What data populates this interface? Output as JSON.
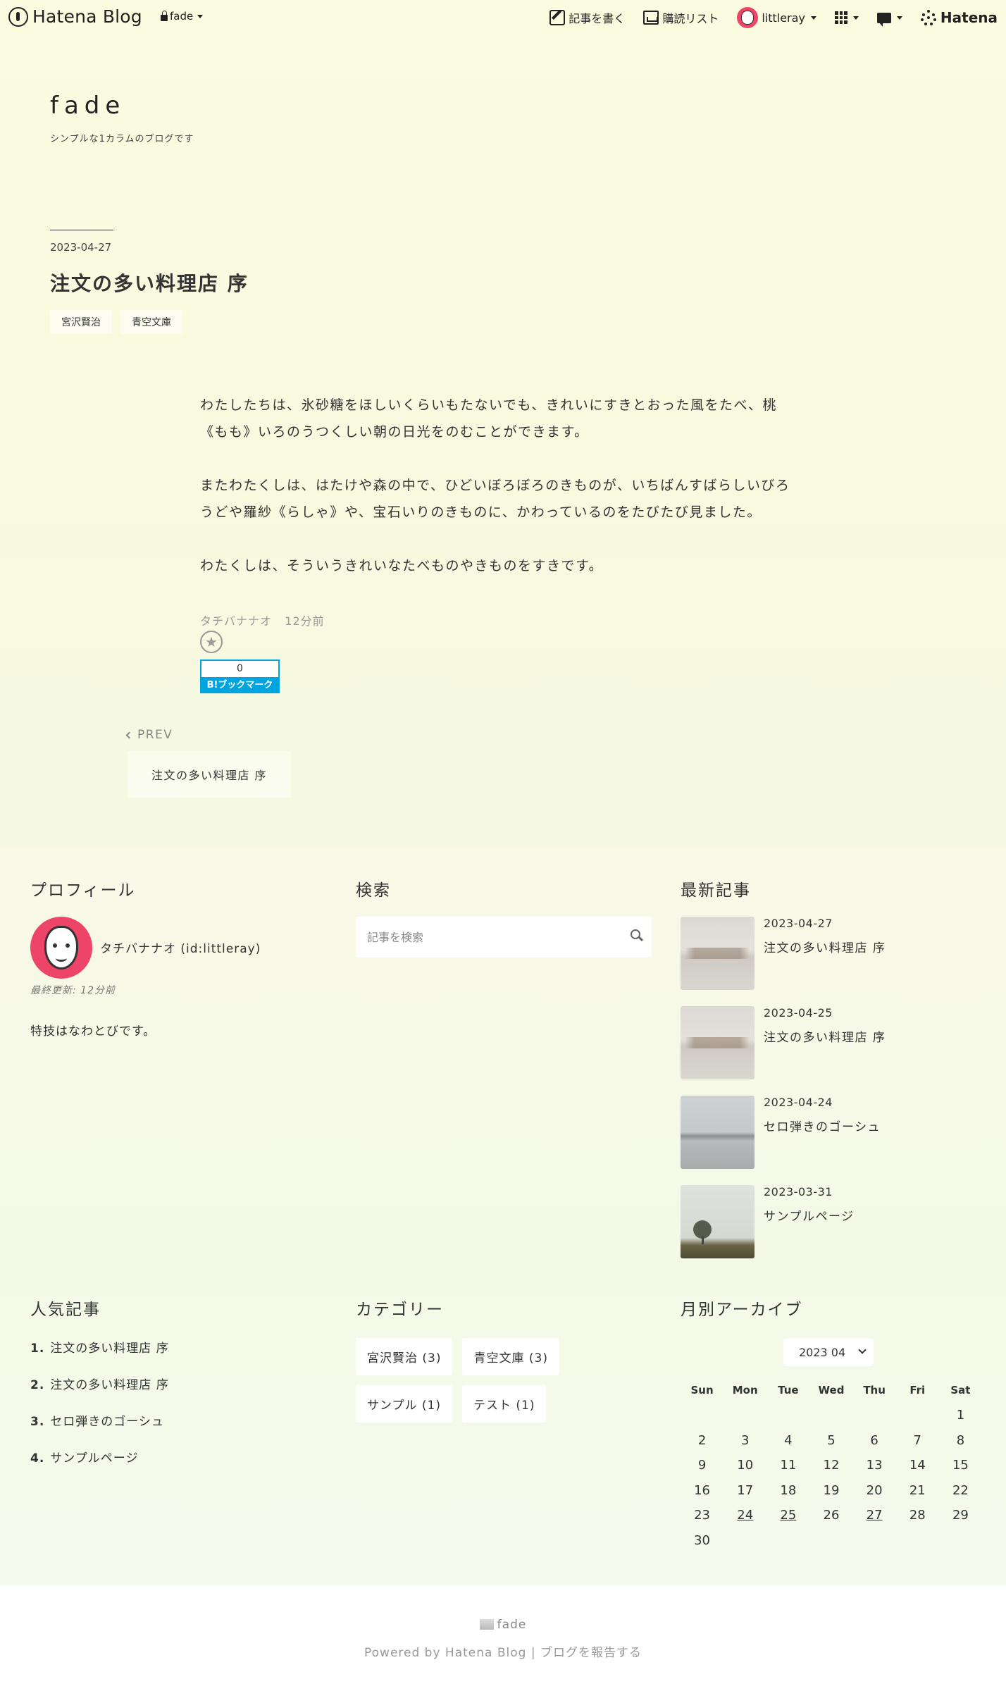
{
  "topbar": {
    "logo_text": "Hatena Blog",
    "blog_select": "fade",
    "write_label": "記事を書く",
    "reading_list_label": "購読リスト",
    "user_label": "littleray",
    "brand_label": "Hatena"
  },
  "header": {
    "title": "fade",
    "description": "シンプルな1カラムのブログです"
  },
  "entry": {
    "date": "2023-04-27",
    "title": "注文の多い料理店 序",
    "tags": [
      "宮沢賢治",
      "青空文庫"
    ],
    "paragraphs": [
      "わたしたちは、氷砂糖をほしいくらいもたないでも、きれいにすきとおった風をたべ、桃《もも》いろのうつくしい朝の日光をのむことができます。",
      "またわたくしは、はたけや森の中で、ひどいぼろぼろのきものが、いちばんすばらしいびろうどや羅紗《らしゃ》や、宝石いりのきものに、かわっているのをたびたび見ました。",
      "わたくしは、そういうきれいなたべものやきものをすきです。"
    ],
    "author": "タチバナナオ",
    "time_ago": "12分前",
    "bookmark_count": "0",
    "bookmark_label": "B!ブックマーク"
  },
  "pager": {
    "label": "PREV",
    "link_title": "注文の多い料理店 序"
  },
  "profile": {
    "heading": "プロフィール",
    "name": "タチバナナオ (id:littleray)",
    "updated": "最終更新: 12分前",
    "description": "特技はなわとびです。"
  },
  "search": {
    "heading": "検索",
    "placeholder": "記事を検索"
  },
  "recent": {
    "heading": "最新記事",
    "items": [
      {
        "date": "2023-04-27",
        "title": "注文の多い料理店 序"
      },
      {
        "date": "2023-04-25",
        "title": "注文の多い料理店 序"
      },
      {
        "date": "2023-04-24",
        "title": "セロ弾きのゴーシュ"
      },
      {
        "date": "2023-03-31",
        "title": "サンプルページ"
      }
    ]
  },
  "popular": {
    "heading": "人気記事",
    "items": [
      {
        "num": "1.",
        "title": "注文の多い料理店 序"
      },
      {
        "num": "2.",
        "title": "注文の多い料理店 序"
      },
      {
        "num": "3.",
        "title": "セロ弾きのゴーシュ"
      },
      {
        "num": "4.",
        "title": "サンプルページ"
      }
    ]
  },
  "categories": {
    "heading": "カテゴリー",
    "items": [
      "宮沢賢治 (3)",
      "青空文庫 (3)",
      "サンプル (1)",
      "テスト (1)"
    ]
  },
  "archive": {
    "heading": "月別アーカイブ",
    "selected": "2023 04",
    "weekdays": [
      "Sun",
      "Mon",
      "Tue",
      "Wed",
      "Thu",
      "Fri",
      "Sat"
    ],
    "weeks": [
      [
        "",
        "",
        "",
        "",
        "",
        "",
        "1"
      ],
      [
        "2",
        "3",
        "4",
        "5",
        "6",
        "7",
        "8"
      ],
      [
        "9",
        "10",
        "11",
        "12",
        "13",
        "14",
        "15"
      ],
      [
        "16",
        "17",
        "18",
        "19",
        "20",
        "21",
        "22"
      ],
      [
        "23",
        "24",
        "25",
        "26",
        "27",
        "28",
        "29"
      ],
      [
        "30",
        "",
        "",
        "",
        "",
        "",
        ""
      ]
    ],
    "linked_days": [
      "24",
      "25",
      "27"
    ]
  },
  "footer": {
    "blog_name": "fade",
    "powered": "Powered by Hatena Blog",
    "separator": "|",
    "report": "ブログを報告する"
  },
  "colors": {
    "accent_bookmark": "#00a4de",
    "avatar_pink": "#ee4468"
  }
}
